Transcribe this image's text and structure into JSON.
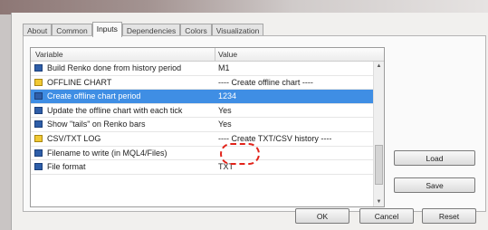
{
  "tabs": [
    "About",
    "Common",
    "Inputs",
    "Dependencies",
    "Colors",
    "Visualization"
  ],
  "active_tab": "Inputs",
  "table": {
    "headers": {
      "variable": "Variable",
      "value": "Value"
    },
    "rows": [
      {
        "icon": "blue",
        "name": "Build Renko done from history period",
        "value": "M1"
      },
      {
        "icon": "yellow",
        "name": "OFFLINE CHART",
        "value": "---- Create offline chart ----"
      },
      {
        "icon": "blue",
        "name": "Create offline chart period",
        "value": "1234",
        "selected": true
      },
      {
        "icon": "blue",
        "name": "Update the offline chart with each tick",
        "value": "Yes"
      },
      {
        "icon": "blue",
        "name": "Show \"tails\" on Renko bars",
        "value": "Yes"
      },
      {
        "icon": "yellow",
        "name": "CSV/TXT LOG",
        "value": "---- Create TXT/CSV history ----"
      },
      {
        "icon": "blue",
        "name": "Filename to write (in MQL4/Files)",
        "value": ""
      },
      {
        "icon": "blue",
        "name": "File format",
        "value": "TXT"
      }
    ]
  },
  "buttons": {
    "load": "Load",
    "save": "Save",
    "ok": "OK",
    "cancel": "Cancel",
    "reset": "Reset"
  },
  "colors": {
    "selection": "#3f8ee4",
    "callout": "#e2231a"
  }
}
